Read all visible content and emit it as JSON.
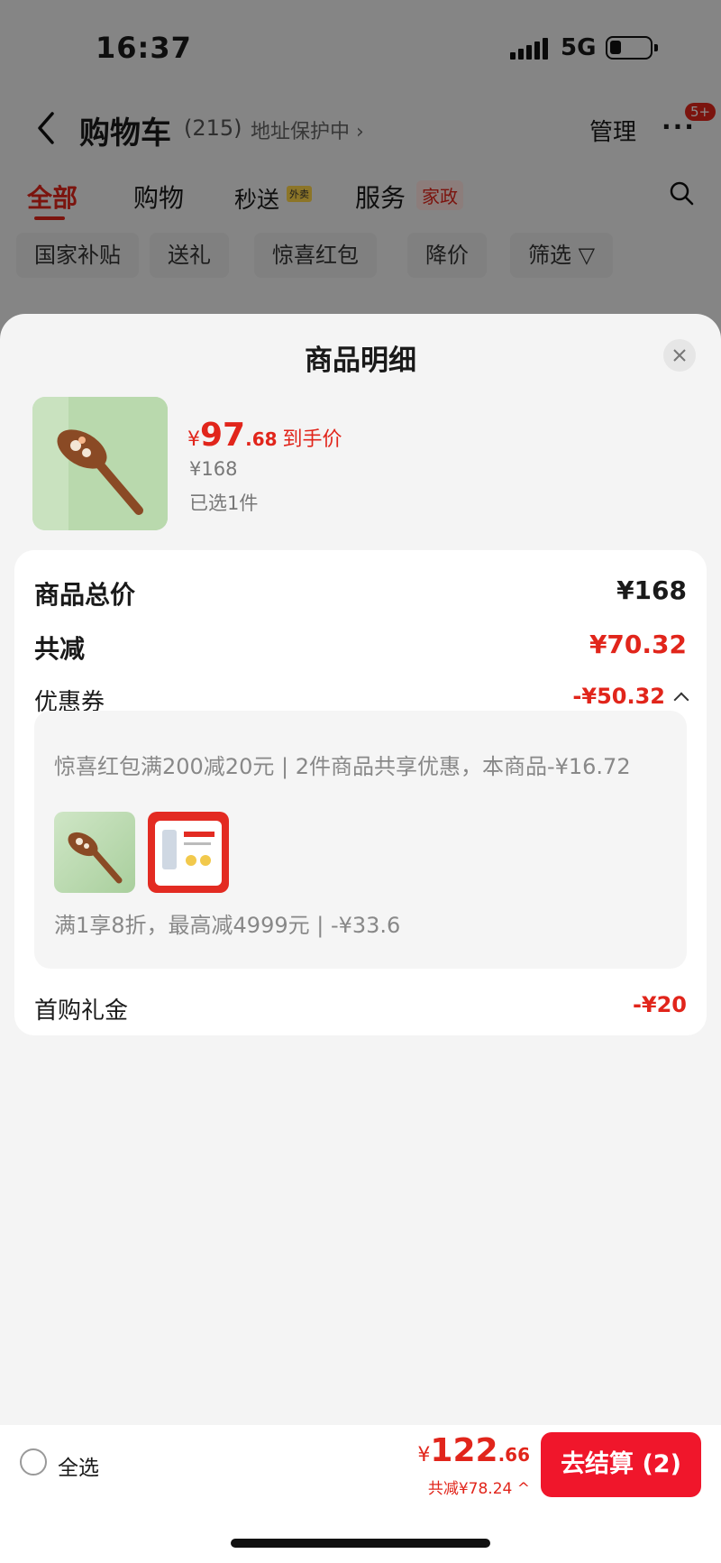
{
  "status_bar": {
    "time": "16:37",
    "network": "5G"
  },
  "nav": {
    "title": "购物车",
    "count": "(215)",
    "address_protect": "地址保护中 ›",
    "manage": "管理",
    "more": "···",
    "badge": "5+"
  },
  "tabs": [
    {
      "label": "全部"
    },
    {
      "label": "购物"
    },
    {
      "label": "秒送"
    },
    {
      "label": "服务"
    }
  ],
  "tab_tags": {
    "takeout": "外卖",
    "housekeeping": "家政"
  },
  "filters": [
    "国家补贴",
    "送礼",
    "惊喜红包",
    "降价",
    "筛选 ▽"
  ],
  "sheet": {
    "title": "商品明细",
    "product": {
      "currency": "¥",
      "price_int": "97",
      "price_dec": ".68",
      "price_tag": "到手价",
      "original_price": "¥168",
      "selected": "已选1件"
    },
    "total_label": "商品总价",
    "total_value": "¥168",
    "reduce_label": "共减",
    "reduce_value": "¥70.32",
    "coupon_label": "优惠券",
    "coupon_value": "-¥50.32",
    "coupon_line1": "惊喜红包满200减20元 | 2件商品共享优惠，本商品-¥16.72",
    "coupon_line2": "满1享8折，最高减4999元 | -¥33.6",
    "gift_label": "首购礼金",
    "gift_value": "-¥20"
  },
  "bottom_bar": {
    "select_all": "全选",
    "currency": "¥",
    "total_int": "122",
    "total_dec": ".66",
    "total_reduce": "共减¥78.24 ^",
    "checkout": "去结算 (2)"
  },
  "colors": {
    "accent": "#e1251b",
    "checkout": "#f0162b"
  }
}
